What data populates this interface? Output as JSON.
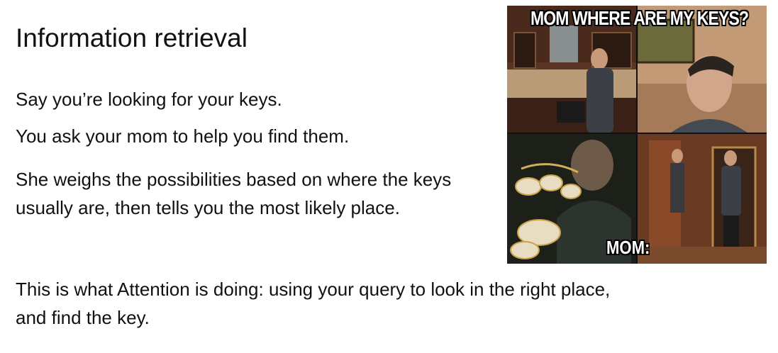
{
  "slide": {
    "title": "Information retrieval",
    "paragraphs": [
      "Say you’re looking for your keys.",
      "You ask your mom to help you find them.",
      "She weighs the possibilities based on where the keys usually are, then tells you the most likely place.",
      "This is what Attention is doing: using your query to look in the right place, and find the key."
    ]
  },
  "meme": {
    "top_caption": "MOM WHERE ARE MY KEYS?",
    "bottom_label": "MOM:"
  },
  "colors": {
    "background": "#ffffff",
    "text": "#111111"
  }
}
